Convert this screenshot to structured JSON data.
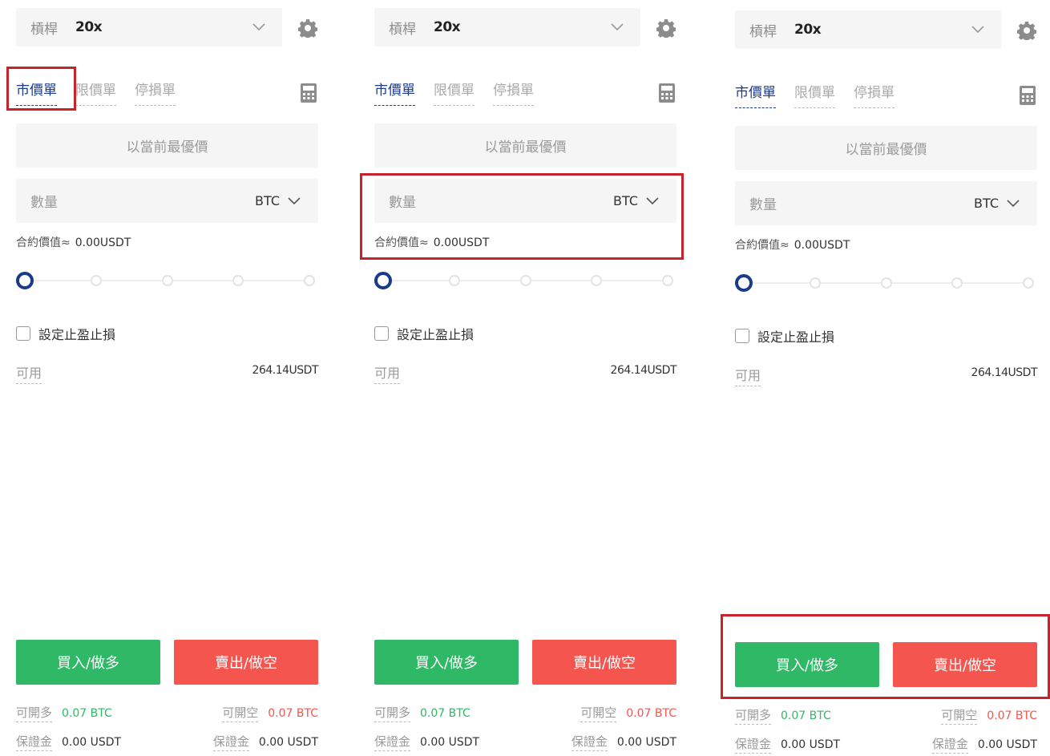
{
  "panels": [
    {
      "leverage_label": "槓桿",
      "leverage_value": "20x",
      "tabs": [
        "市價單",
        "限價單",
        "停損單"
      ],
      "price_placeholder": "以當前最優價",
      "qty_label": "數量",
      "qty_unit": "BTC",
      "contract_label": "合約價值≈",
      "contract_value": "0.00USDT",
      "tpsl_label": "設定止盈止損",
      "available_label": "可用",
      "available_value": "264.14USDT",
      "buy_label": "買入/做多",
      "sell_label": "賣出/做空",
      "long_label": "可開多",
      "long_value": "0.07 BTC",
      "short_label": "可開空",
      "short_value": "0.07 BTC",
      "margin_label": "保證金",
      "margin_buy_value": "0.00 USDT",
      "margin_sell_value": "0.00 USDT",
      "slider_level": 0
    },
    {
      "leverage_label": "槓桿",
      "leverage_value": "20x",
      "tabs": [
        "市價單",
        "限價單",
        "停損單"
      ],
      "price_placeholder": "以當前最優價",
      "qty_label": "數量",
      "qty_unit": "BTC",
      "contract_label": "合約價值≈",
      "contract_value": "0.00USDT",
      "tpsl_label": "設定止盈止損",
      "available_label": "可用",
      "available_value": "264.14USDT",
      "buy_label": "買入/做多",
      "sell_label": "賣出/做空",
      "long_label": "可開多",
      "long_value": "0.07 BTC",
      "short_label": "可開空",
      "short_value": "0.07 BTC",
      "margin_label": "保證金",
      "margin_buy_value": "0.00 USDT",
      "margin_sell_value": "0.00 USDT",
      "slider_level": 0
    },
    {
      "leverage_label": "槓桿",
      "leverage_value": "20x",
      "tabs": [
        "市價單",
        "限價單",
        "停損單"
      ],
      "price_placeholder": "以當前最優價",
      "qty_label": "數量",
      "qty_unit": "BTC",
      "contract_label": "合約價值≈",
      "contract_value": "0.00USDT",
      "tpsl_label": "設定止盈止損",
      "available_label": "可用",
      "available_value": "264.14USDT",
      "buy_label": "買入/做多",
      "sell_label": "賣出/做空",
      "long_label": "可開多",
      "long_value": "0.07 BTC",
      "short_label": "可開空",
      "short_value": "0.07 BTC",
      "margin_label": "保證金",
      "margin_buy_value": "0.00 USDT",
      "margin_sell_value": "0.00 USDT",
      "slider_level": 0
    }
  ],
  "colors": {
    "buy": "#2fb865",
    "sell": "#f4554f",
    "accent": "#1a3a8c",
    "highlight": "#c8222a"
  },
  "icons": [
    "chevron-down-icon",
    "gear-icon",
    "calculator-icon"
  ],
  "highlights": [
    "market-order-tab",
    "quantity-section",
    "buy-sell-buttons"
  ]
}
